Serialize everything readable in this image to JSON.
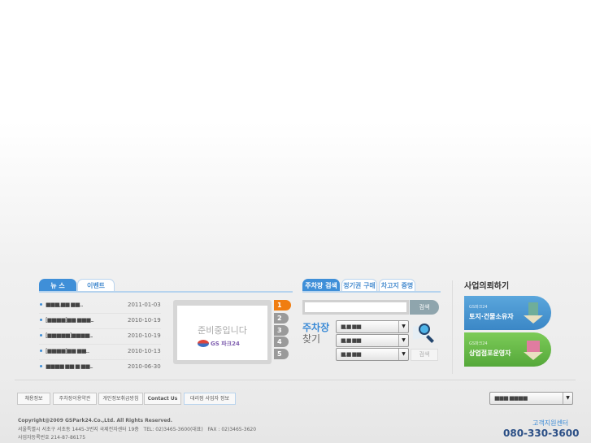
{
  "news": {
    "tabs": [
      {
        "label": "뉴 스"
      },
      {
        "label": "이벤트"
      }
    ],
    "items": [
      {
        "title": "■■■,■■ ■■...",
        "date": "2011-01-03"
      },
      {
        "title": "[■■■■]■■ ■■■...",
        "date": "2010-10-19"
      },
      {
        "title": "[■■■■■]■■■■...",
        "date": "2010-10-19"
      },
      {
        "title": "[■■■■]■■ ■■...",
        "date": "2010-10-13"
      },
      {
        "title": "■■■■ ■■ ■ ■■...",
        "date": "2010-06-30"
      }
    ]
  },
  "banner": {
    "text": "준비중입니다",
    "logo": "GS 파크24",
    "pages": [
      "1",
      "2",
      "3",
      "4",
      "5"
    ]
  },
  "parking": {
    "tabs": [
      {
        "label": "주차장 검색"
      },
      {
        "label": "정기권 구매"
      },
      {
        "label": "차고지 증명"
      }
    ],
    "search_value": "",
    "search_button": "검색",
    "find_title_1": "주차장",
    "find_title_2": "찾기",
    "selects": [
      "■,■ ■■",
      "■,■ ■■",
      "■,■ ■■"
    ],
    "find_button": "검색"
  },
  "business": {
    "title": "사업의뢰하기",
    "cards": [
      {
        "small": "GS파크24",
        "label": "토지·건물소유자"
      },
      {
        "small": "GS파크24",
        "label": "상업점포운영자"
      }
    ]
  },
  "footer": {
    "links": [
      "채용정보",
      "주차장이용약관",
      "개인정보취급방침",
      "Contact Us",
      "대리점 사업자 정보"
    ],
    "family_select": "■■■ ■■■■",
    "copyright": "Copyright@2009 GSPark24.Co.,Ltd. All Rights Reserved.",
    "address": "서울특별시 서초구 서초동 1445-3번지 국제전자센터 19층   TEL: 02)3465-3600(대표)   FAX : 02)3465-3620",
    "bizno": "사업자등록번호  214-87-86175",
    "support_label": "고객지원센터",
    "support_phone": "080-330-3600"
  },
  "colors": {
    "accent": "#3f8fd8",
    "orange": "#f07d10",
    "blue_card": "#4a9ad6",
    "green_card": "#6cbf4a",
    "navy": "#2b4f86"
  }
}
